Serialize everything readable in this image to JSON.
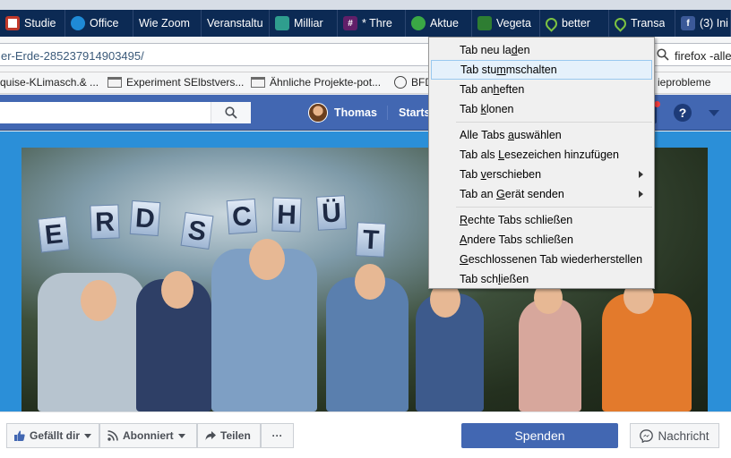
{
  "tabs": [
    {
      "label": "Studie",
      "icon": "studie-favicon",
      "color": "#c0392b"
    },
    {
      "label": "Office",
      "icon": "office-favicon",
      "color": "#1f8ad6"
    },
    {
      "label": "Wie Zoom",
      "icon": "",
      "color": ""
    },
    {
      "label": "Veranstaltu",
      "icon": "",
      "color": ""
    },
    {
      "label": "Milliar",
      "icon": "milliar-favicon",
      "color": "#2f9e8e"
    },
    {
      "label": "* Thre",
      "icon": "slack-favicon",
      "color": "#611f69"
    },
    {
      "label": "Aktue",
      "icon": "globe-green-favicon",
      "color": "#3aa845"
    },
    {
      "label": "Vegeta",
      "icon": "vegeta-favicon",
      "color": "#2e7d32"
    },
    {
      "label": "better",
      "icon": "pin-green-favicon",
      "color": "#7cc242"
    },
    {
      "label": "Transa",
      "icon": "pin-green-favicon",
      "color": "#7cc242"
    },
    {
      "label": "(3) Ini",
      "icon": "facebook-favicon",
      "color": "#3b5998"
    }
  ],
  "address": {
    "url": "er-Erde-285237914903495/",
    "search_query": "firefox -alle"
  },
  "bookmarks": [
    {
      "label": "quise-KLimasch.& ..."
    },
    {
      "label": "Experiment SElbstvers..."
    },
    {
      "label": "Ähnliche Projekte-pot..."
    },
    {
      "label": "BFD"
    },
    {
      "label": "ieprobleme"
    }
  ],
  "fb_header": {
    "user_name": "Thomas",
    "home_label": "Starts",
    "help_label": "?"
  },
  "cover": {
    "letters": [
      "E",
      "R",
      "D",
      "S",
      "C",
      "H",
      "Ü",
      "T"
    ]
  },
  "actions": {
    "like_label": "Gefällt dir",
    "follow_label": "Abonniert",
    "share_label": "Teilen",
    "more_label": "···",
    "donate_label": "Spenden",
    "message_label": "Nachricht"
  },
  "context_menu": {
    "groups": [
      [
        {
          "pre": "Tab neu la",
          "key": "d",
          "post": "en",
          "submenu": false,
          "highlighted": false
        },
        {
          "pre": "Tab stu",
          "key": "m",
          "post": "mschalten",
          "submenu": false,
          "highlighted": true
        },
        {
          "pre": "Tab an",
          "key": "h",
          "post": "eften",
          "submenu": false,
          "highlighted": false
        },
        {
          "pre": "Tab ",
          "key": "k",
          "post": "lonen",
          "submenu": false,
          "highlighted": false
        }
      ],
      [
        {
          "pre": "Alle Tabs ",
          "key": "a",
          "post": "uswählen",
          "submenu": false,
          "highlighted": false
        },
        {
          "pre": "Tab als ",
          "key": "L",
          "post": "esezeichen hinzufügen",
          "submenu": false,
          "highlighted": false
        },
        {
          "pre": "Tab ",
          "key": "v",
          "post": "erschieben",
          "submenu": true,
          "highlighted": false
        },
        {
          "pre": "Tab an ",
          "key": "G",
          "post": "erät senden",
          "submenu": true,
          "highlighted": false
        }
      ],
      [
        {
          "pre": "",
          "key": "R",
          "post": "echte Tabs schließen",
          "submenu": false,
          "highlighted": false
        },
        {
          "pre": "",
          "key": "A",
          "post": "ndere Tabs schließen",
          "submenu": false,
          "highlighted": false
        },
        {
          "pre": "",
          "key": "G",
          "post": "eschlossenen Tab wiederherstellen",
          "submenu": false,
          "highlighted": false
        },
        {
          "pre": "Tab sch",
          "key": "l",
          "post": "ießen",
          "submenu": false,
          "highlighted": false
        }
      ]
    ]
  },
  "colors": {
    "tabstrip": "#0c2a54",
    "fb_blue": "#4267b2",
    "cover_blue": "#2b8fd8",
    "menu_bg": "#f0f0f0",
    "menu_highlight": "#e5f1fb"
  }
}
